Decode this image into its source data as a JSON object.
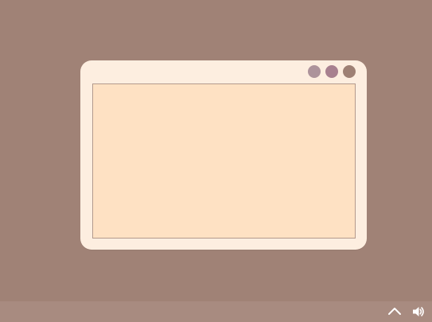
{
  "theme": {
    "desktop_bg": "#a08276",
    "window_bg": "#fdeee0",
    "content_bg": "#fee1c3",
    "taskbar_bg": "#a88b80",
    "icon_color": "#ffffff"
  },
  "window": {
    "controls": [
      {
        "name": "minimize-button",
        "color": "#ad939b"
      },
      {
        "name": "maximize-button",
        "color": "#a8808f"
      },
      {
        "name": "close-button",
        "color": "#9e8074"
      }
    ]
  },
  "taskbar": {
    "tray_icons": [
      "chevron-up-icon",
      "speaker-icon"
    ]
  }
}
